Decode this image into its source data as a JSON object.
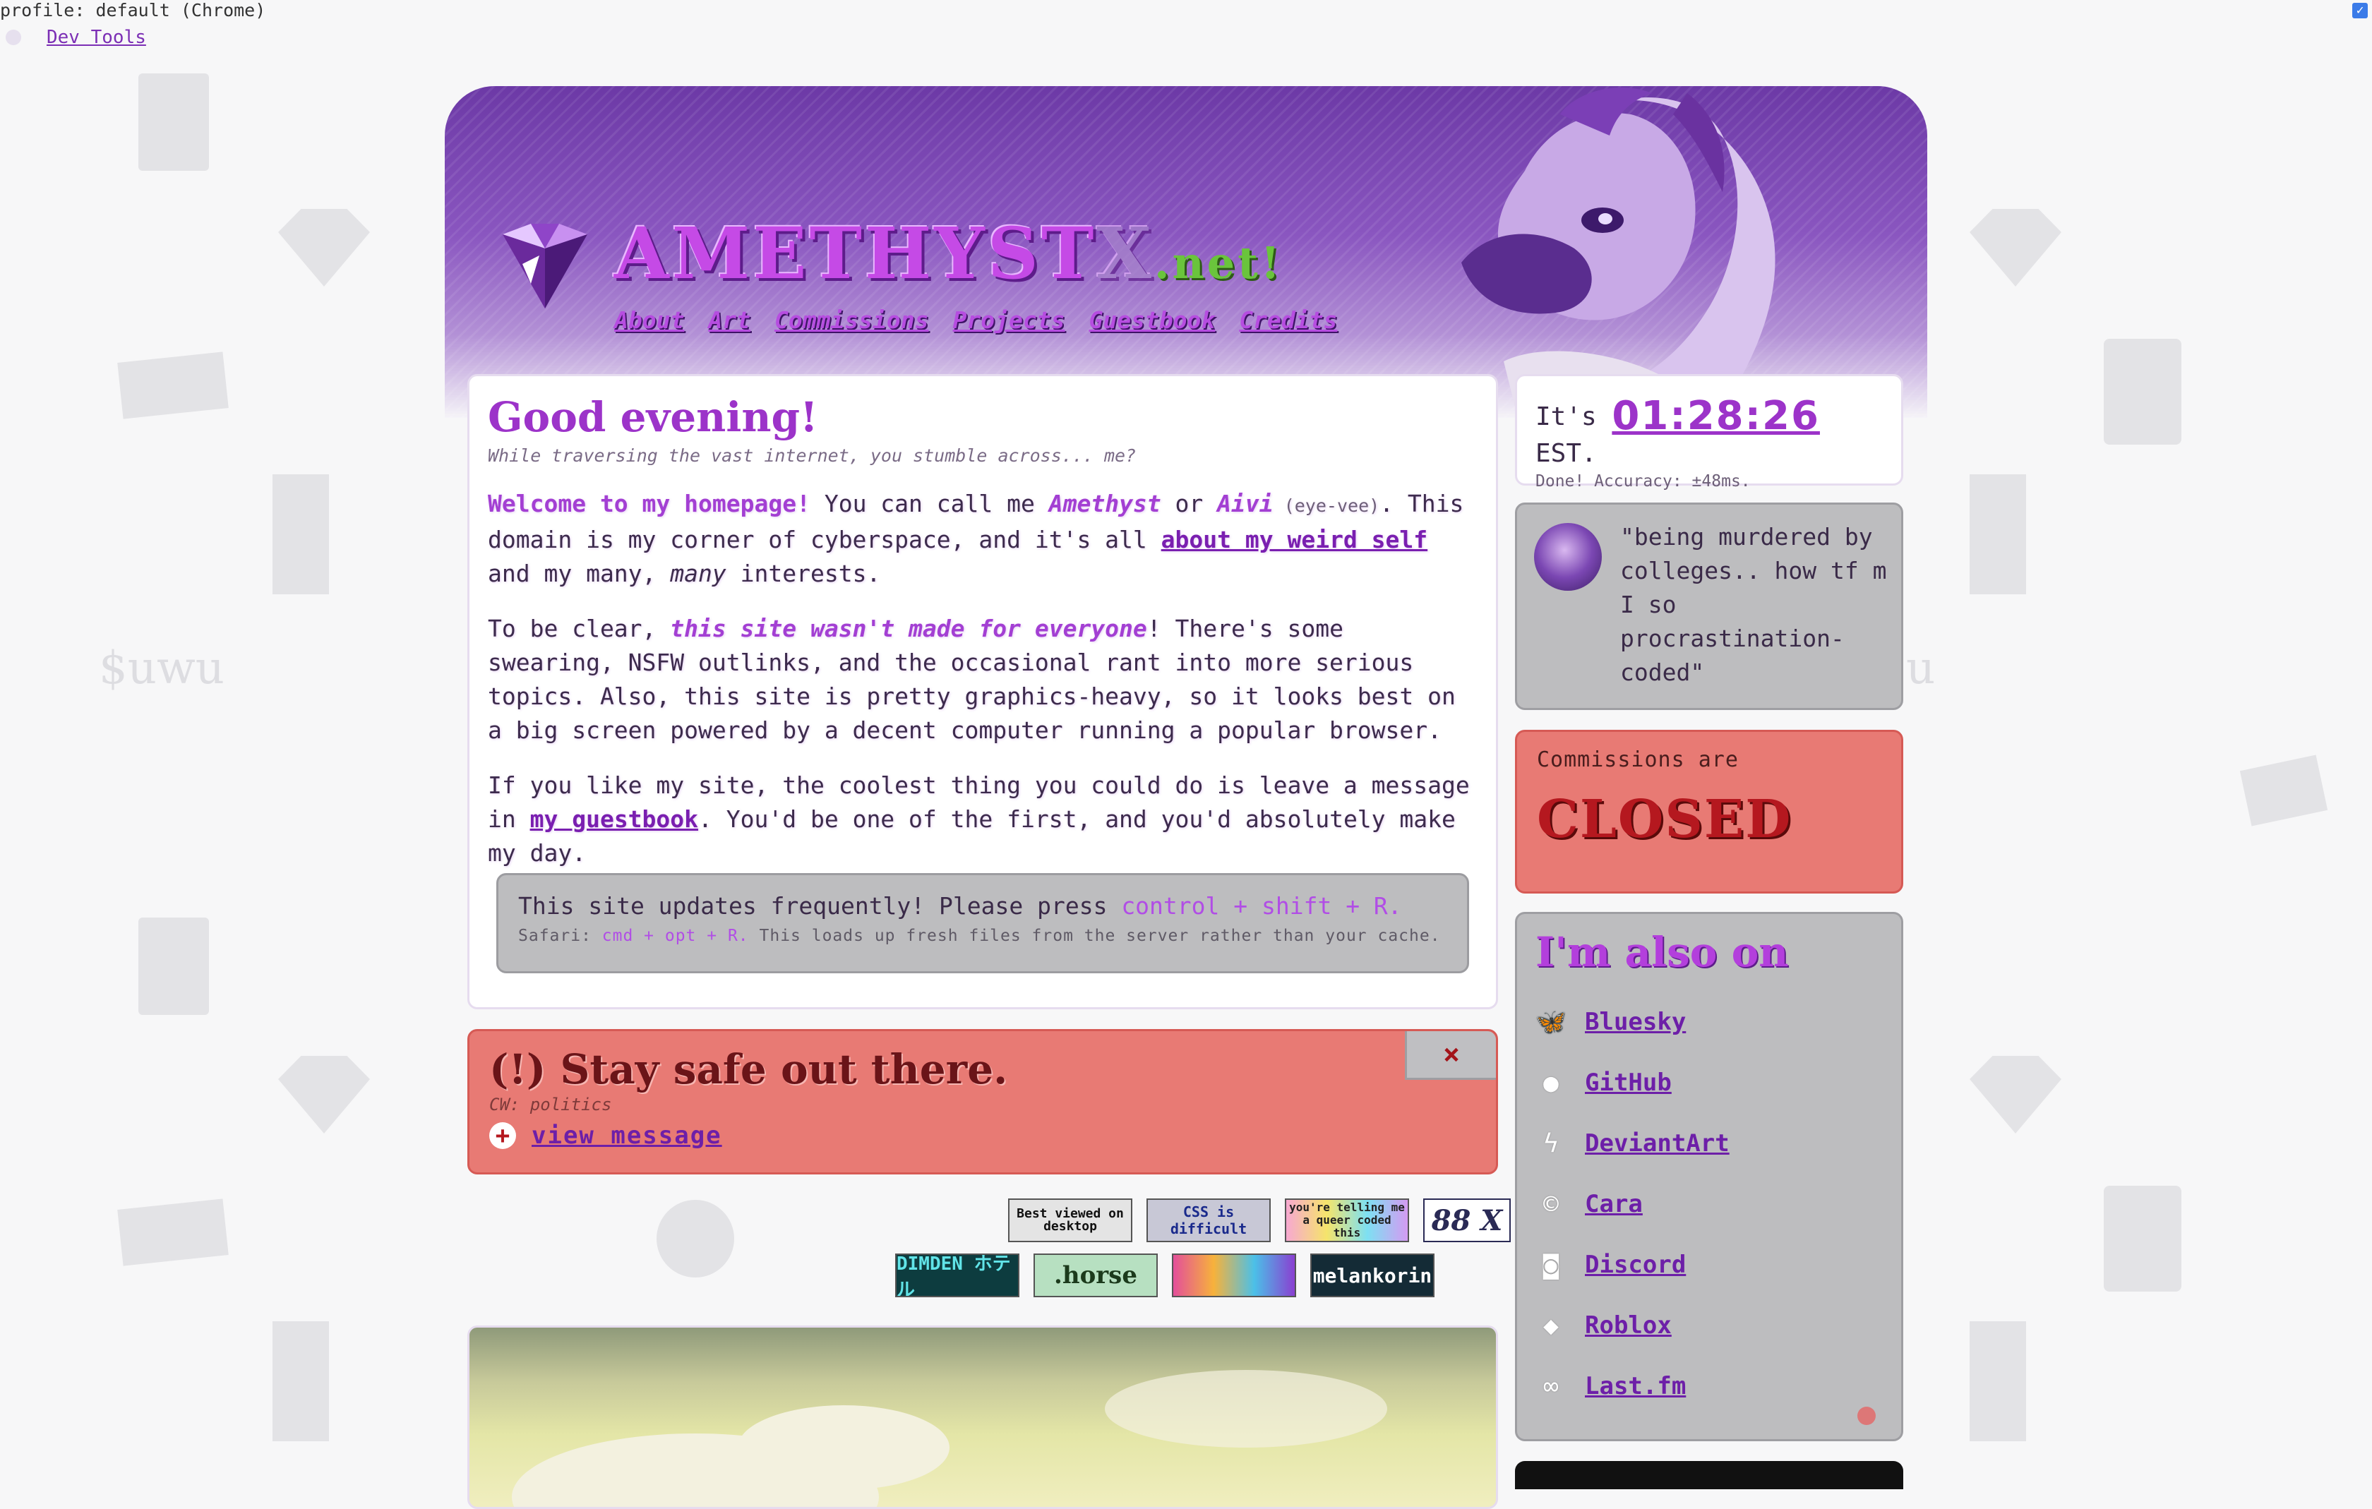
{
  "browser": {
    "profile_line": "profile: default (Chrome)",
    "devtools_label": "Dev Tools"
  },
  "background": {
    "uwu_left": "$uwu",
    "uwu_right": "u"
  },
  "header": {
    "title_main": "AMETHYST",
    "title_x": "X",
    "title_tld": ".net!",
    "nav": [
      "About",
      "Art",
      "Commissions",
      "Projects",
      "Guestbook",
      "Credits"
    ]
  },
  "welcome": {
    "greeting": "Good evening!",
    "subtitle": "While traversing the vast internet, you stumble across... me?",
    "p1": {
      "intro": "Welcome to my homepage!",
      "t1": " You can call me ",
      "name1": "Amethyst",
      "t2": " or ",
      "name2": "Aivi",
      "pron": " (eye-vee)",
      "t3": ". This domain is my corner of cyberspace, and it's all ",
      "link": "about my weird self",
      "t4": " and my many, ",
      "many": "many",
      "t5": " interests."
    },
    "p2": {
      "t1": "To be clear, ",
      "emph": "this site wasn't made for everyone",
      "t2": "! There's some swearing, NSFW outlinks, and the occasional rant into more serious topics. Also, this site is pretty graphics-heavy, so it looks best on a big screen powered by a decent computer running a popular browser."
    },
    "p3": {
      "t1": "If you like my site, the coolest thing you could do is leave a message in ",
      "link": "my guestbook",
      "t2": ". You'd be one of the first, and you'd absolutely make my day."
    },
    "update": {
      "main": "This site updates frequently! Please press ",
      "keys": "control + shift + R.",
      "safari_label": "Safari: ",
      "safari_keys": "cmd + opt + R.",
      "safari_rest": " This loads up fresh files from the server rather than your cache."
    }
  },
  "clock": {
    "prefix": "It's ",
    "time": "01:28:26",
    "zone": " EST.",
    "accuracy": "Done! Accuracy: ±48ms."
  },
  "status": {
    "text": "\"being murdered by colleges.. how tf m I so procrastination-coded\""
  },
  "commissions": {
    "label": "Commissions are",
    "state": "CLOSED"
  },
  "social": {
    "title": "I'm also on",
    "items": [
      {
        "label": "Bluesky",
        "icon": "butterfly-icon"
      },
      {
        "label": "GitHub",
        "icon": "github-icon"
      },
      {
        "label": "DeviantArt",
        "icon": "deviantart-icon"
      },
      {
        "label": "Cara",
        "icon": "cara-icon"
      },
      {
        "label": "Discord",
        "icon": "discord-icon"
      },
      {
        "label": "Roblox",
        "icon": "roblox-icon"
      },
      {
        "label": "Last.fm",
        "icon": "lastfm-icon"
      }
    ]
  },
  "warning": {
    "title": "(!) Stay safe out there.",
    "cw": "CW: politics",
    "view": "view message",
    "close": "×"
  },
  "badges": {
    "row1": [
      "Best viewed on desktop",
      "CSS is difficult",
      "you're telling me a queer coded this",
      "88 X"
    ],
    "row2": [
      "DIMDEN ホテル",
      ".horse",
      "",
      "melankorin"
    ]
  },
  "colors": {
    "accent": "#9c33c9",
    "closed_red": "#b5181f",
    "panel_gray": "#bdbdbf",
    "warn_red": "#e87a74"
  }
}
